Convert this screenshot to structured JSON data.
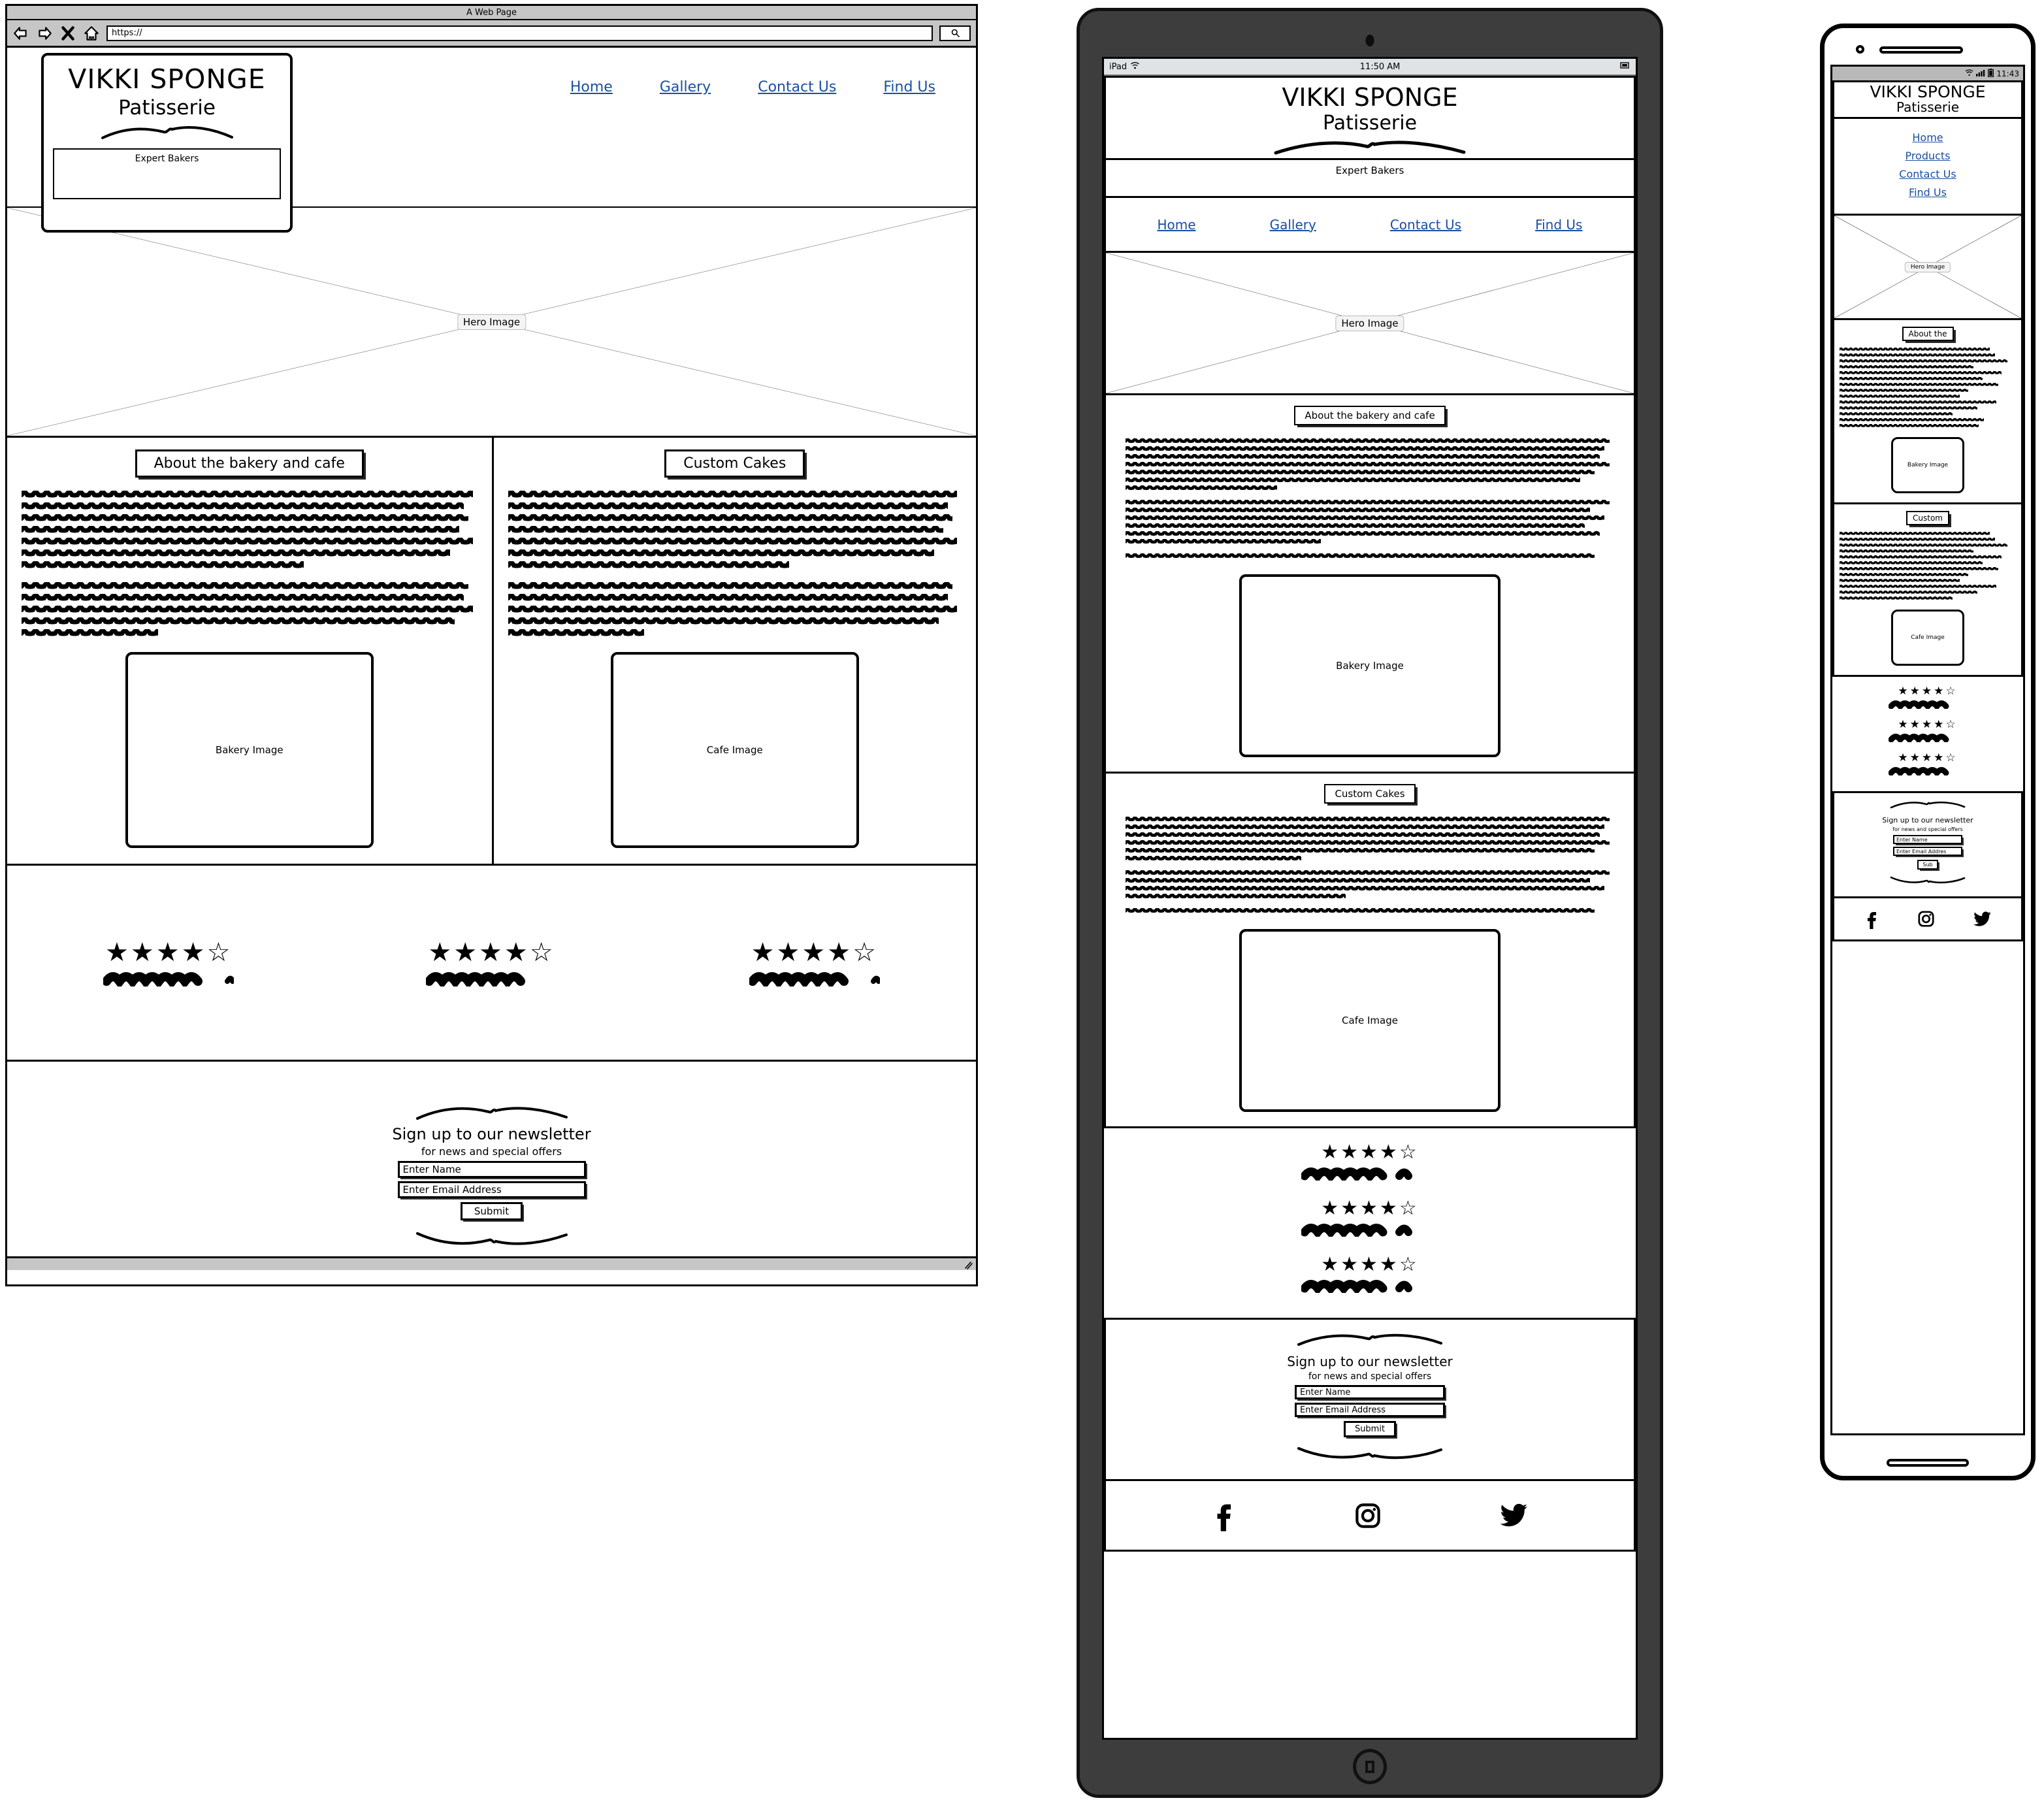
{
  "browser": {
    "window_title": "A Web Page",
    "url_value": "https://",
    "icons": {
      "back": "back-arrow-icon",
      "forward": "forward-arrow-icon",
      "stop": "close-icon",
      "home": "home-icon",
      "search": "search-icon"
    }
  },
  "brand": {
    "line1": "VIKKI SPONGE",
    "line2": "Patisserie",
    "tagline": "Expert Bakers"
  },
  "desktop_nav": [
    {
      "label": "Home"
    },
    {
      "label": "Gallery"
    },
    {
      "label": "Contact Us"
    },
    {
      "label": "Find Us"
    }
  ],
  "tablet_nav": [
    {
      "label": "Home"
    },
    {
      "label": "Gallery"
    },
    {
      "label": "Contact Us"
    },
    {
      "label": "Find Us"
    }
  ],
  "mobile_nav": [
    {
      "label": "Home"
    },
    {
      "label": "Products"
    },
    {
      "label": "Contact Us"
    },
    {
      "label": "Find Us"
    }
  ],
  "hero": {
    "label": "Hero Image"
  },
  "sections": {
    "about": {
      "heading": "About the bakery and cafe",
      "heading_mobile": "About the",
      "image_label": "Bakery Image"
    },
    "cakes": {
      "heading": "Custom Cakes",
      "heading_mobile": "Custom",
      "image_label": "Cafe Image"
    }
  },
  "reviews": [
    {
      "stars_filled": 4,
      "stars_empty": 1,
      "text": "scribble-placeholder"
    },
    {
      "stars_filled": 4,
      "stars_empty": 1,
      "text": "scribble-placeholder"
    },
    {
      "stars_filled": 4,
      "stars_empty": 1,
      "text": "scribble-placeholder"
    }
  ],
  "newsletter": {
    "title": "Sign up to our newsletter",
    "subtitle": "for news and special offers",
    "name_placeholder": "Enter Name",
    "email_placeholder": "Enter Email Address",
    "email_placeholder_mobile": "Enter Email Addres",
    "submit_label": "Submit",
    "submit_label_mobile": "Sub"
  },
  "social": [
    {
      "name": "facebook-icon"
    },
    {
      "name": "instagram-icon"
    },
    {
      "name": "twitter-icon"
    }
  ],
  "tablet_status": {
    "carrier": "iPad",
    "time": "11:50 AM"
  },
  "phone_status": {
    "time": "11:43"
  },
  "colors": {
    "link": "#1a4fa0",
    "chrome": "#c6c6c6",
    "ios_status": "#dfe3e6",
    "android_status": "#b9b9b9",
    "ink": "#000000"
  }
}
